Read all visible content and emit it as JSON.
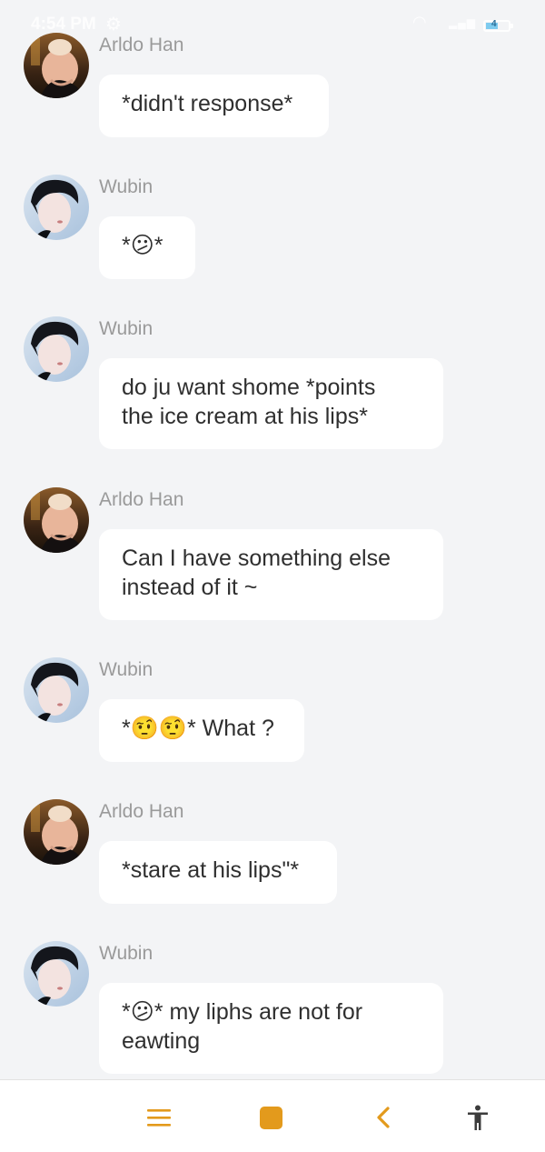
{
  "status_bar": {
    "time": "4:54 PM",
    "battery": "4"
  },
  "messages": [
    {
      "sender": "Arldo Han",
      "avatar": "arldo-avatar",
      "text": "*didn't response*"
    },
    {
      "sender": "Wubin",
      "avatar": "wubin-avatar",
      "text": "*😕*"
    },
    {
      "sender": "Wubin",
      "avatar": "wubin-avatar",
      "text": "do ju want shome *points\nthe ice cream at his lips*"
    },
    {
      "sender": "Arldo Han",
      "avatar": "arldo-avatar",
      "text": "Can I have something else\ninstead of it ~"
    },
    {
      "sender": "Wubin",
      "avatar": "wubin-avatar",
      "text": "*🤨🤨* What ?"
    },
    {
      "sender": "Arldo Han",
      "avatar": "arldo-avatar",
      "text": "*stare at his lips\"*"
    },
    {
      "sender": "Wubin",
      "avatar": "wubin-avatar",
      "text": "*😕* my liphs are not for\neawting"
    }
  ],
  "nav": {
    "items": [
      "menu-icon",
      "home-icon",
      "back-icon",
      "accessibility-icon"
    ],
    "accent_color": "#e39a1c"
  }
}
